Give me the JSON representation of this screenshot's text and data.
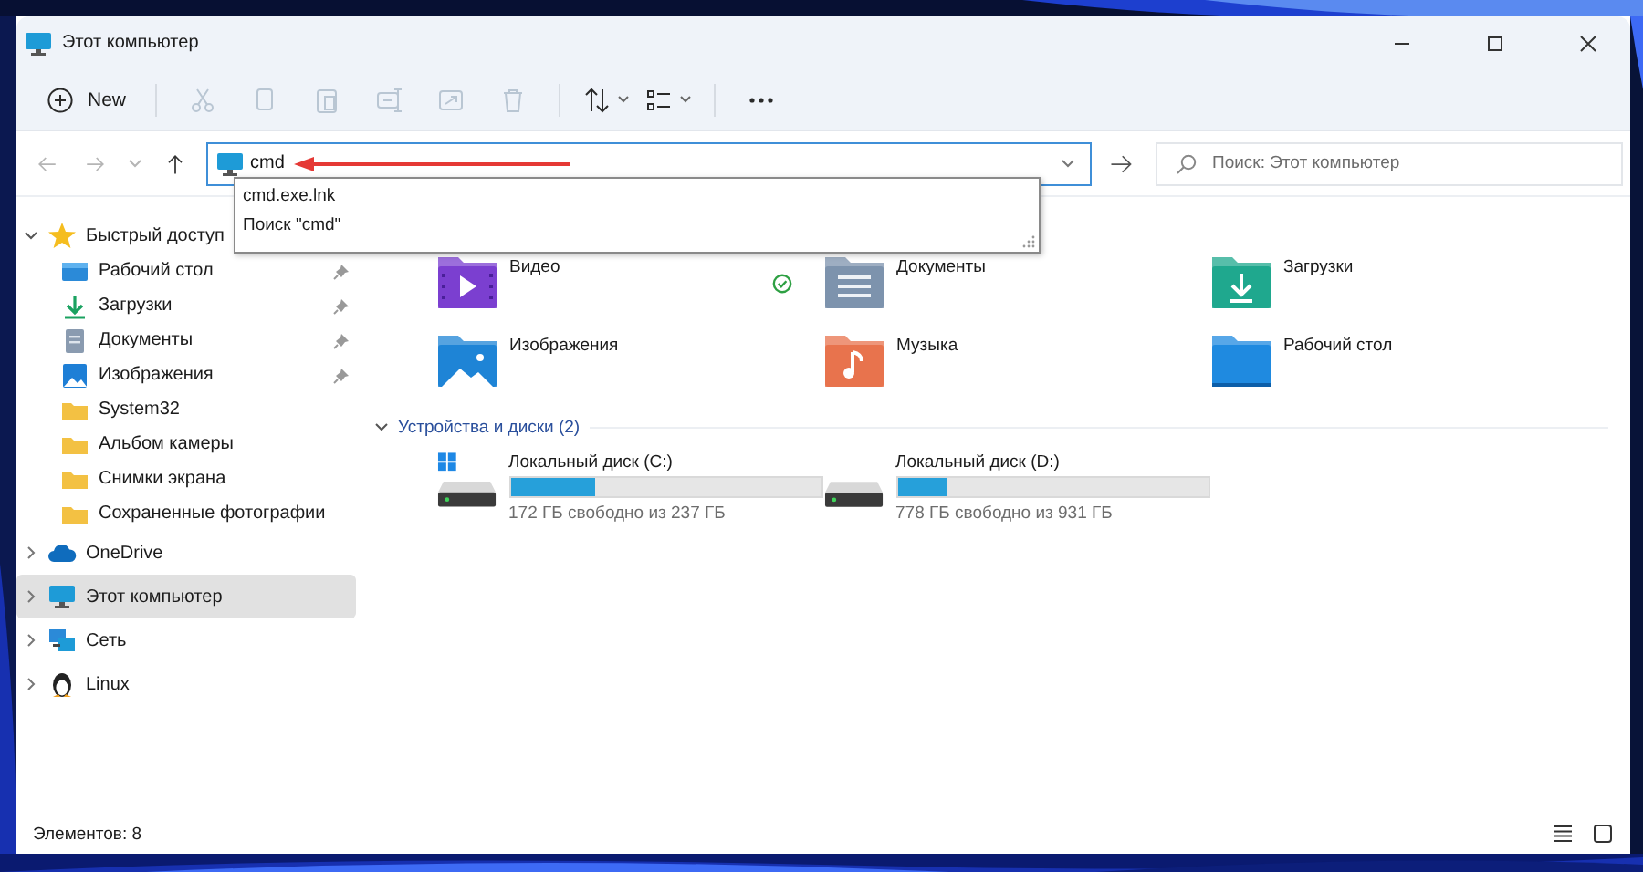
{
  "window": {
    "title": "Этот компьютер"
  },
  "toolbar": [
    {
      "kind": "new",
      "label": "New",
      "disabled": false
    },
    {
      "kind": "cut",
      "disabled": true
    },
    {
      "kind": "copy",
      "disabled": true
    },
    {
      "kind": "paste",
      "disabled": true
    },
    {
      "kind": "rename",
      "disabled": true
    },
    {
      "kind": "share",
      "disabled": true
    },
    {
      "kind": "delete",
      "disabled": true
    },
    {
      "kind": "sort",
      "disabled": false
    },
    {
      "kind": "view",
      "disabled": false
    },
    {
      "kind": "more",
      "disabled": false
    }
  ],
  "nav": [
    {
      "kind": "back",
      "disabled": true
    },
    {
      "kind": "forward",
      "disabled": true
    },
    {
      "kind": "recent",
      "disabled": true
    },
    {
      "kind": "up",
      "disabled": false
    }
  ],
  "address": {
    "value": "cmd",
    "suggestions": [
      "cmd.exe.lnk",
      "Поиск \"cmd\""
    ]
  },
  "search": {
    "placeholder": "Поиск: Этот компьютер"
  },
  "sidebar": [
    {
      "label": "Быстрый доступ",
      "kind": "star",
      "expanded": true,
      "selected": false,
      "children": [
        {
          "label": "Рабочий стол",
          "kind": "desktop",
          "pinned": true
        },
        {
          "label": "Загрузки",
          "kind": "download",
          "pinned": true
        },
        {
          "label": "Документы",
          "kind": "document",
          "pinned": true
        },
        {
          "label": "Изображения",
          "kind": "pictures",
          "pinned": true
        },
        {
          "label": "System32",
          "kind": "folder",
          "pinned": false
        },
        {
          "label": "Альбом камеры",
          "kind": "folder",
          "pinned": false
        },
        {
          "label": "Снимки экрана",
          "kind": "folder",
          "pinned": false
        },
        {
          "label": "Сохраненные фотографии",
          "kind": "folder",
          "pinned": false
        }
      ]
    },
    {
      "label": "OneDrive",
      "kind": "cloud",
      "expanded": false,
      "selected": false
    },
    {
      "label": "Этот компьютер",
      "kind": "monitor",
      "expanded": false,
      "selected": true
    },
    {
      "label": "Сеть",
      "kind": "network",
      "expanded": false,
      "selected": false
    },
    {
      "label": "Linux",
      "kind": "penguin",
      "expanded": false,
      "selected": false
    }
  ],
  "folders": [
    {
      "name": "Видео",
      "kind": "video",
      "synced": true
    },
    {
      "name": "Документы",
      "kind": "documents",
      "synced": false
    },
    {
      "name": "Загрузки",
      "kind": "downloads",
      "synced": false
    },
    {
      "name": "Изображения",
      "kind": "pictures",
      "synced": false
    },
    {
      "name": "Музыка",
      "kind": "music",
      "synced": false
    },
    {
      "name": "Рабочий стол",
      "kind": "desktop",
      "synced": false
    }
  ],
  "devices": {
    "title": "Устройства и диски (2)",
    "expanded": true,
    "drives": [
      {
        "name": "Локальный диск (C:)",
        "kind": "system",
        "level": 0.27,
        "free": "172 ГБ свободно из 237 ГБ"
      },
      {
        "name": "Локальный диск (D:)",
        "kind": "plain",
        "level": 0.16,
        "free": "778 ГБ свободно из 931 ГБ"
      }
    ]
  },
  "status_bar": {
    "text": "Элементов: 8",
    "views": [
      {
        "kind": "details"
      },
      {
        "kind": "tiles"
      }
    ]
  }
}
